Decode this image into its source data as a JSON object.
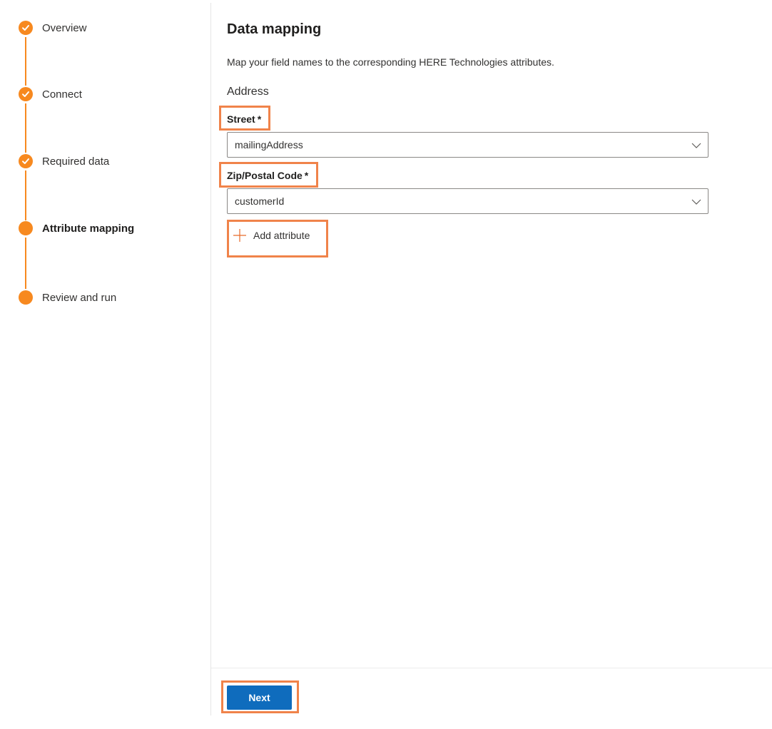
{
  "stepper": {
    "steps": [
      {
        "label": "Overview",
        "state": "complete"
      },
      {
        "label": "Connect",
        "state": "complete"
      },
      {
        "label": "Required data",
        "state": "complete"
      },
      {
        "label": "Attribute mapping",
        "state": "current"
      },
      {
        "label": "Review and run",
        "state": "upcoming"
      }
    ]
  },
  "main": {
    "title": "Data mapping",
    "subtitle": "Map your field names to the corresponding HERE Technologies attributes.",
    "section": "Address",
    "fields": [
      {
        "label": "Street",
        "required_mark": "*",
        "value": "mailingAddress"
      },
      {
        "label": "Zip/Postal Code",
        "required_mark": "*",
        "value": "customerId"
      }
    ],
    "add_attribute_label": "Add attribute"
  },
  "footer": {
    "next_label": "Next"
  },
  "colors": {
    "accent": "#f7891f",
    "primary_button": "#0f6cbd",
    "highlight": "#f0834a"
  },
  "icons": {
    "complete": "checkmark-icon",
    "select": "chevron-down-icon",
    "add": "plus-icon"
  }
}
